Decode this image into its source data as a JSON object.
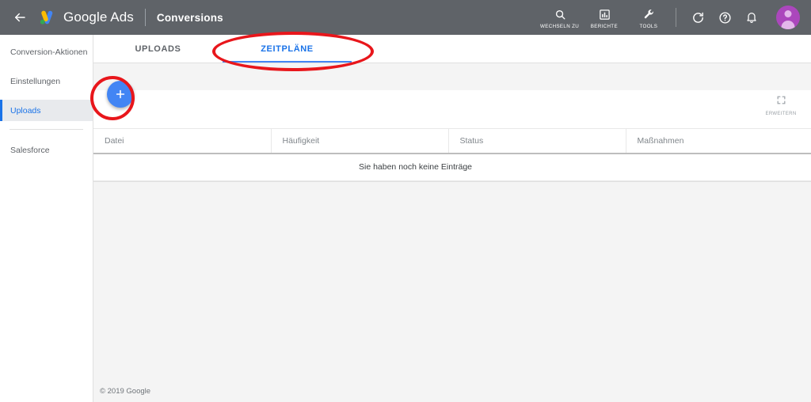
{
  "topbar": {
    "back_icon": "back-arrow-icon",
    "logo_icon": "google-ads-logo",
    "brand": "Google Ads",
    "page_title": "Conversions",
    "tools": [
      {
        "icon": "search-icon",
        "label": "WECHSELN ZU"
      },
      {
        "icon": "bar-chart-icon",
        "label": "BERICHTE"
      },
      {
        "icon": "wrench-icon",
        "label": "TOOLS"
      }
    ],
    "actions": [
      {
        "icon": "refresh-icon"
      },
      {
        "icon": "help-icon"
      },
      {
        "icon": "bell-icon"
      }
    ],
    "avatar": "user-avatar",
    "colors": {
      "bar": "#5f6368",
      "avatar": "#ab47bc"
    }
  },
  "sidebar": {
    "items": [
      {
        "label": "Conversion-Aktionen",
        "selected": false
      },
      {
        "label": "Einstellungen",
        "selected": false
      },
      {
        "label": "Uploads",
        "selected": true
      },
      {
        "label": "Salesforce",
        "selected": false
      }
    ],
    "selected_color": "#1a73e8"
  },
  "tabs": [
    {
      "label": "UPLOADS",
      "active": false
    },
    {
      "label": "ZEITPLÄNE",
      "active": true
    }
  ],
  "card": {
    "add_button": {
      "icon": "plus-icon",
      "tooltip": "+"
    },
    "expand": {
      "icon": "expand-icon",
      "label": "ERWEITERN"
    },
    "table": {
      "columns": [
        "Datei",
        "Häufigkeit",
        "Status",
        "Maßnahmen"
      ],
      "rows": [],
      "empty_message": "Sie haben noch keine Einträge"
    }
  },
  "footer": {
    "copyright": "© 2019 Google"
  },
  "annotations": [
    {
      "name": "highlight-zeitplaene-tab",
      "shape": "ellipse",
      "color": "#e8161b"
    },
    {
      "name": "highlight-add-button",
      "shape": "circle",
      "color": "#e8161b"
    }
  ]
}
